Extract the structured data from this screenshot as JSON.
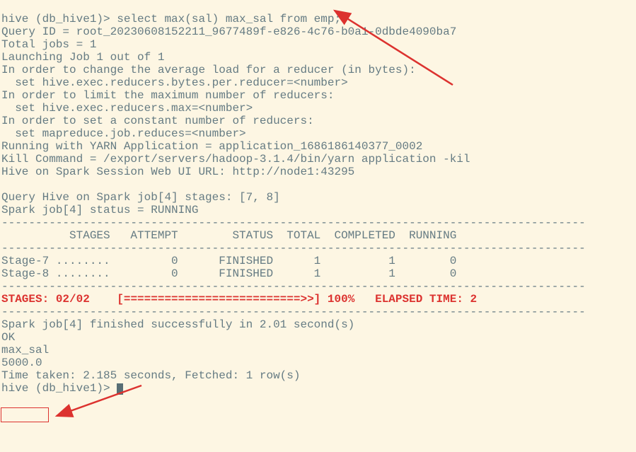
{
  "lines": {
    "l0": "hive (db_hive1)> select max(sal) max_sal from emp;",
    "l1": "Query ID = root_20230608152211_9677489f-e826-4c76-b0a1-0dbde4090ba7",
    "l2": "Total jobs = 1",
    "l3": "Launching Job 1 out of 1",
    "l4": "In order to change the average load for a reducer (in bytes):",
    "l5": "  set hive.exec.reducers.bytes.per.reducer=<number>",
    "l6": "In order to limit the maximum number of reducers:",
    "l7": "  set hive.exec.reducers.max=<number>",
    "l8": "In order to set a constant number of reducers:",
    "l9": "  set mapreduce.job.reduces=<number>",
    "l10": "Running with YARN Application = application_1686186140377_0002",
    "l11": "Kill Command = /export/servers/hadoop-3.1.4/bin/yarn application -kil",
    "l12": "Hive on Spark Session Web UI URL: http://node1:43295",
    "l13": "",
    "l14": "Query Hive on Spark job[4] stages: [7, 8]",
    "l15": "Spark job[4] status = RUNNING",
    "l16": "--------------------------------------------------------------------------------------",
    "l17": "          STAGES   ATTEMPT        STATUS  TOTAL  COMPLETED  RUNNING  ",
    "l18": "--------------------------------------------------------------------------------------",
    "l19": "Stage-7 ........         0      FINISHED      1          1        0",
    "l20": "Stage-8 ........         0      FINISHED      1          1        0",
    "l21": "--------------------------------------------------------------------------------------",
    "l22a": "STAGES: 02/02    ",
    "l22b": "[==========================>>] 100%   ELAPSED TIME: 2",
    "l23": "--------------------------------------------------------------------------------------",
    "l24": "Spark job[4] finished successfully in 2.01 second(s)",
    "l25": "OK",
    "l26": "max_sal",
    "l27": "5000.0",
    "l28": "Time taken: 2.185 seconds, Fetched: 1 row(s)",
    "l29": "hive (db_hive1)> "
  },
  "chart_data": null
}
